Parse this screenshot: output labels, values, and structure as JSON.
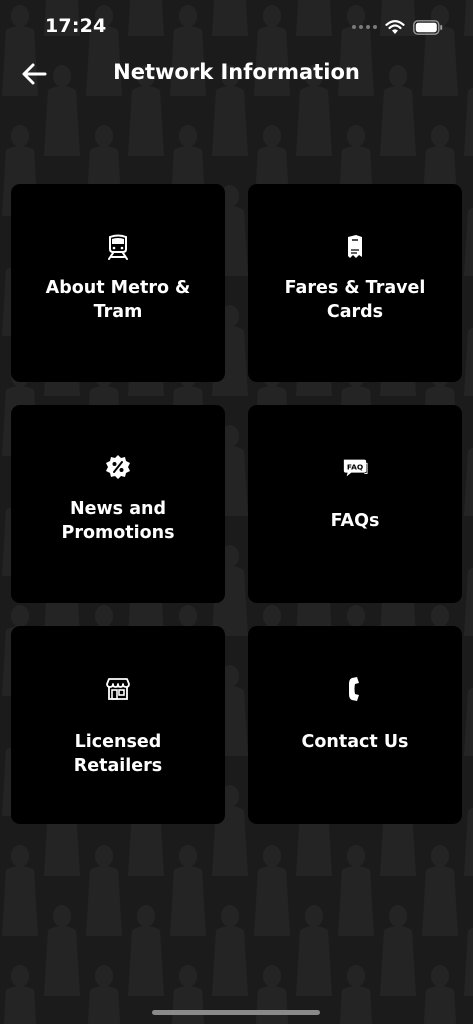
{
  "status_bar": {
    "time": "17:24"
  },
  "header": {
    "title": "Network Information",
    "back_icon": "arrow-left-icon"
  },
  "menu": {
    "items": [
      {
        "label": "About Metro & Tram",
        "icon": "train-icon"
      },
      {
        "label": "Fares & Travel Cards",
        "icon": "ticket-icon"
      },
      {
        "label": "News and Promotions",
        "icon": "discount-badge-icon"
      },
      {
        "label": "FAQs",
        "icon": "faq-bubble-icon"
      },
      {
        "label": "Licensed Retailers",
        "icon": "storefront-icon"
      },
      {
        "label": "Contact Us",
        "icon": "phone-icon"
      }
    ]
  },
  "colors": {
    "background": "#1b1b1b",
    "card": "#000000",
    "text": "#ffffff",
    "pattern": "#262626"
  }
}
